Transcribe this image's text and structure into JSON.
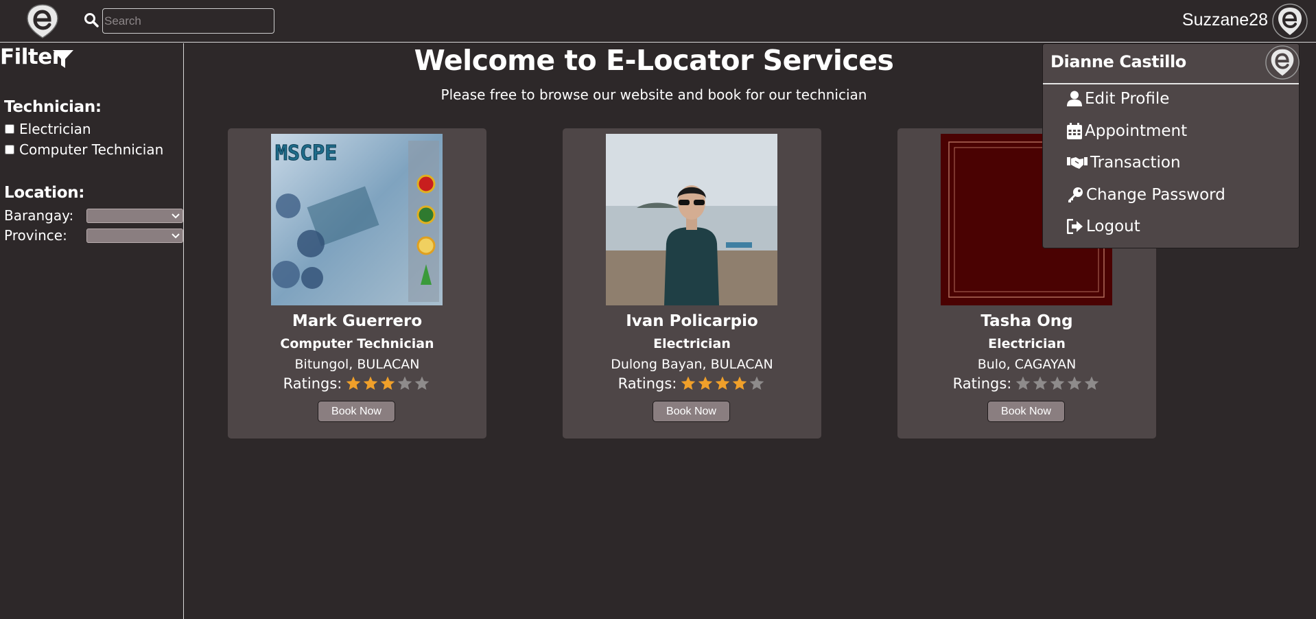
{
  "header": {
    "logo": "e-locator-logo",
    "search_placeholder": "Search",
    "username": "Suzzane28"
  },
  "sidebar": {
    "filter_label": "Filter",
    "technician_heading": "Technician:",
    "technician_options": [
      {
        "label": "Electrician",
        "checked": false
      },
      {
        "label": "Computer Technician",
        "checked": false
      }
    ],
    "location_heading": "Location:",
    "barangay_label": "Barangay:",
    "province_label": "Province:",
    "barangay_value": "",
    "province_value": ""
  },
  "main": {
    "welcome": "Welcome to E-Locator Services",
    "subtitle": "Please free to browse our website and book for our technician",
    "ratings_label": "Ratings:",
    "book_label": "Book Now",
    "technicians": [
      {
        "name": "Mark Guerrero",
        "role": "Computer Technician",
        "location": "Bitungol, BULACAN",
        "rating": 3,
        "max_rating": 5,
        "photo": "mscpe-poster",
        "poster_text": "MSCPE"
      },
      {
        "name": "Ivan Policarpio",
        "role": "Electrician",
        "location": "Dulong Bayan, BULACAN",
        "rating": 4,
        "max_rating": 5,
        "photo": "beach-portrait"
      },
      {
        "name": "Tasha Ong",
        "role": "Electrician",
        "location": "Bulo, CAGAYAN",
        "rating": 0,
        "max_rating": 5,
        "photo": "maroon-placeholder"
      }
    ]
  },
  "dropdown": {
    "name": "Dianne Castillo",
    "items": [
      {
        "label": "Edit Profile",
        "icon": "user-icon"
      },
      {
        "label": "Appointment",
        "icon": "calendar-icon"
      },
      {
        "label": "Transaction",
        "icon": "handshake-icon"
      },
      {
        "label": "Change Password",
        "icon": "key-icon"
      },
      {
        "label": "Logout",
        "icon": "logout-icon"
      }
    ]
  },
  "colors": {
    "background": "#2d2829",
    "panel": "#4e4647",
    "button": "#8a7e80",
    "star_filled": "#f0a02a",
    "star_empty": "#8e8b8b"
  }
}
